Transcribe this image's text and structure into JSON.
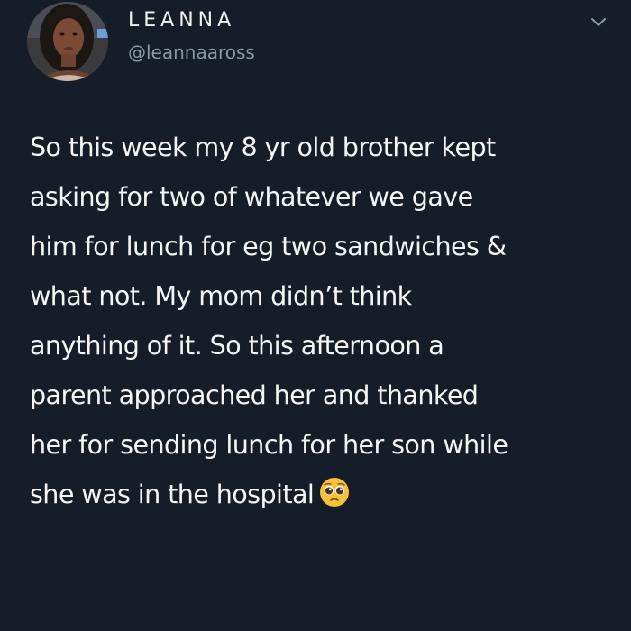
{
  "user": {
    "display_name": "LEANNA",
    "handle": "@leannaaross",
    "avatar_icon": "profile-photo"
  },
  "menu": {
    "icon": "chevron-down-icon"
  },
  "tweet": {
    "lines": [
      "So this week my 8 yr old brother kept",
      "asking for two of whatever we gave",
      "him for lunch for eg two sandwiches &",
      "what not. My mom didn’t think",
      "anything of it. So this afternoon a",
      "parent approached her and thanked",
      "her for sending lunch for her son while",
      "she was in the hospital"
    ],
    "trailing_emoji": "pleading-face-emoji"
  },
  "colors": {
    "background": "#151d28",
    "text": "#f5f5f5",
    "handle": "#8899a6",
    "emoji_face": "#f7c23a"
  }
}
